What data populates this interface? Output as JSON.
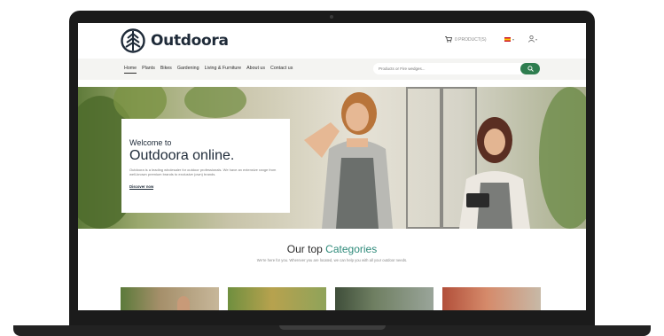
{
  "brand": {
    "name": "Outdoora"
  },
  "header": {
    "cart_label": "0 PRODUCT(S)",
    "colors": {
      "brand_dark": "#1e2a38",
      "accent_green": "#2e7d4f",
      "accent_teal": "#2e8a7a"
    }
  },
  "nav": {
    "items": [
      {
        "label": "Home",
        "active": true
      },
      {
        "label": "Plants"
      },
      {
        "label": "Bikes"
      },
      {
        "label": "Gardening"
      },
      {
        "label": "Living & Furniture"
      },
      {
        "label": "About us"
      },
      {
        "label": "Contact us"
      }
    ]
  },
  "search": {
    "placeholder": "Products or Fire wedges..."
  },
  "hero": {
    "kicker": "Welcome to",
    "title": "Outdoora online.",
    "text": "Outdoora is a leading wholesaler for outdoor professionals. We have an extensive range from well-known premium brands to exclusive (own) brands.",
    "link": "Discover now"
  },
  "categories": {
    "title_prefix": "Our top",
    "title_accent": "Categories",
    "subtitle": "We're here for you. Wherever you are located, we can help you with all your outdoor needs."
  },
  "icons": {
    "cart": "cart-icon",
    "user": "user-icon",
    "search": "search-icon",
    "logo": "logo-mark-icon"
  }
}
